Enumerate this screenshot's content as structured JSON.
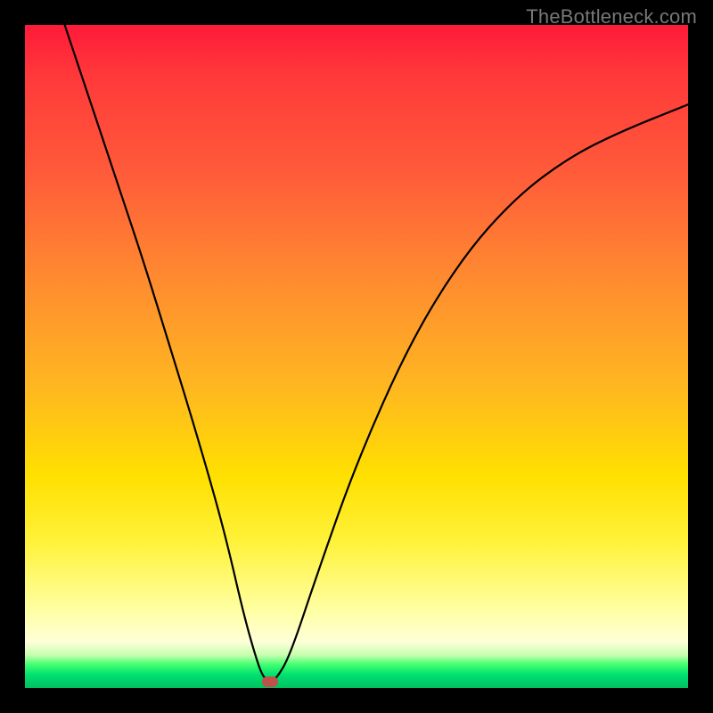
{
  "watermark": "TheBottleneck.com",
  "chart_data": {
    "type": "line",
    "title": "",
    "xlabel": "",
    "ylabel": "",
    "xlim": [
      0,
      100
    ],
    "ylim": [
      0,
      100
    ],
    "series": [
      {
        "name": "curve",
        "x": [
          6,
          10,
          14,
          18,
          22,
          26,
          30,
          33,
          35,
          36,
          37,
          38,
          40,
          44,
          50,
          58,
          66,
          74,
          82,
          90,
          100
        ],
        "y": [
          100,
          88,
          76,
          64,
          51,
          38,
          24,
          11,
          4,
          1.5,
          1,
          1.5,
          5,
          17,
          34,
          52,
          65,
          74,
          80,
          84,
          88
        ]
      }
    ],
    "marker": {
      "x": 37,
      "y": 1
    },
    "background_gradient": {
      "top": "#ff1a3a",
      "mid1": "#ff8a30",
      "mid2": "#ffe000",
      "lower": "#ffffa0",
      "bottom": "#00c060"
    }
  }
}
